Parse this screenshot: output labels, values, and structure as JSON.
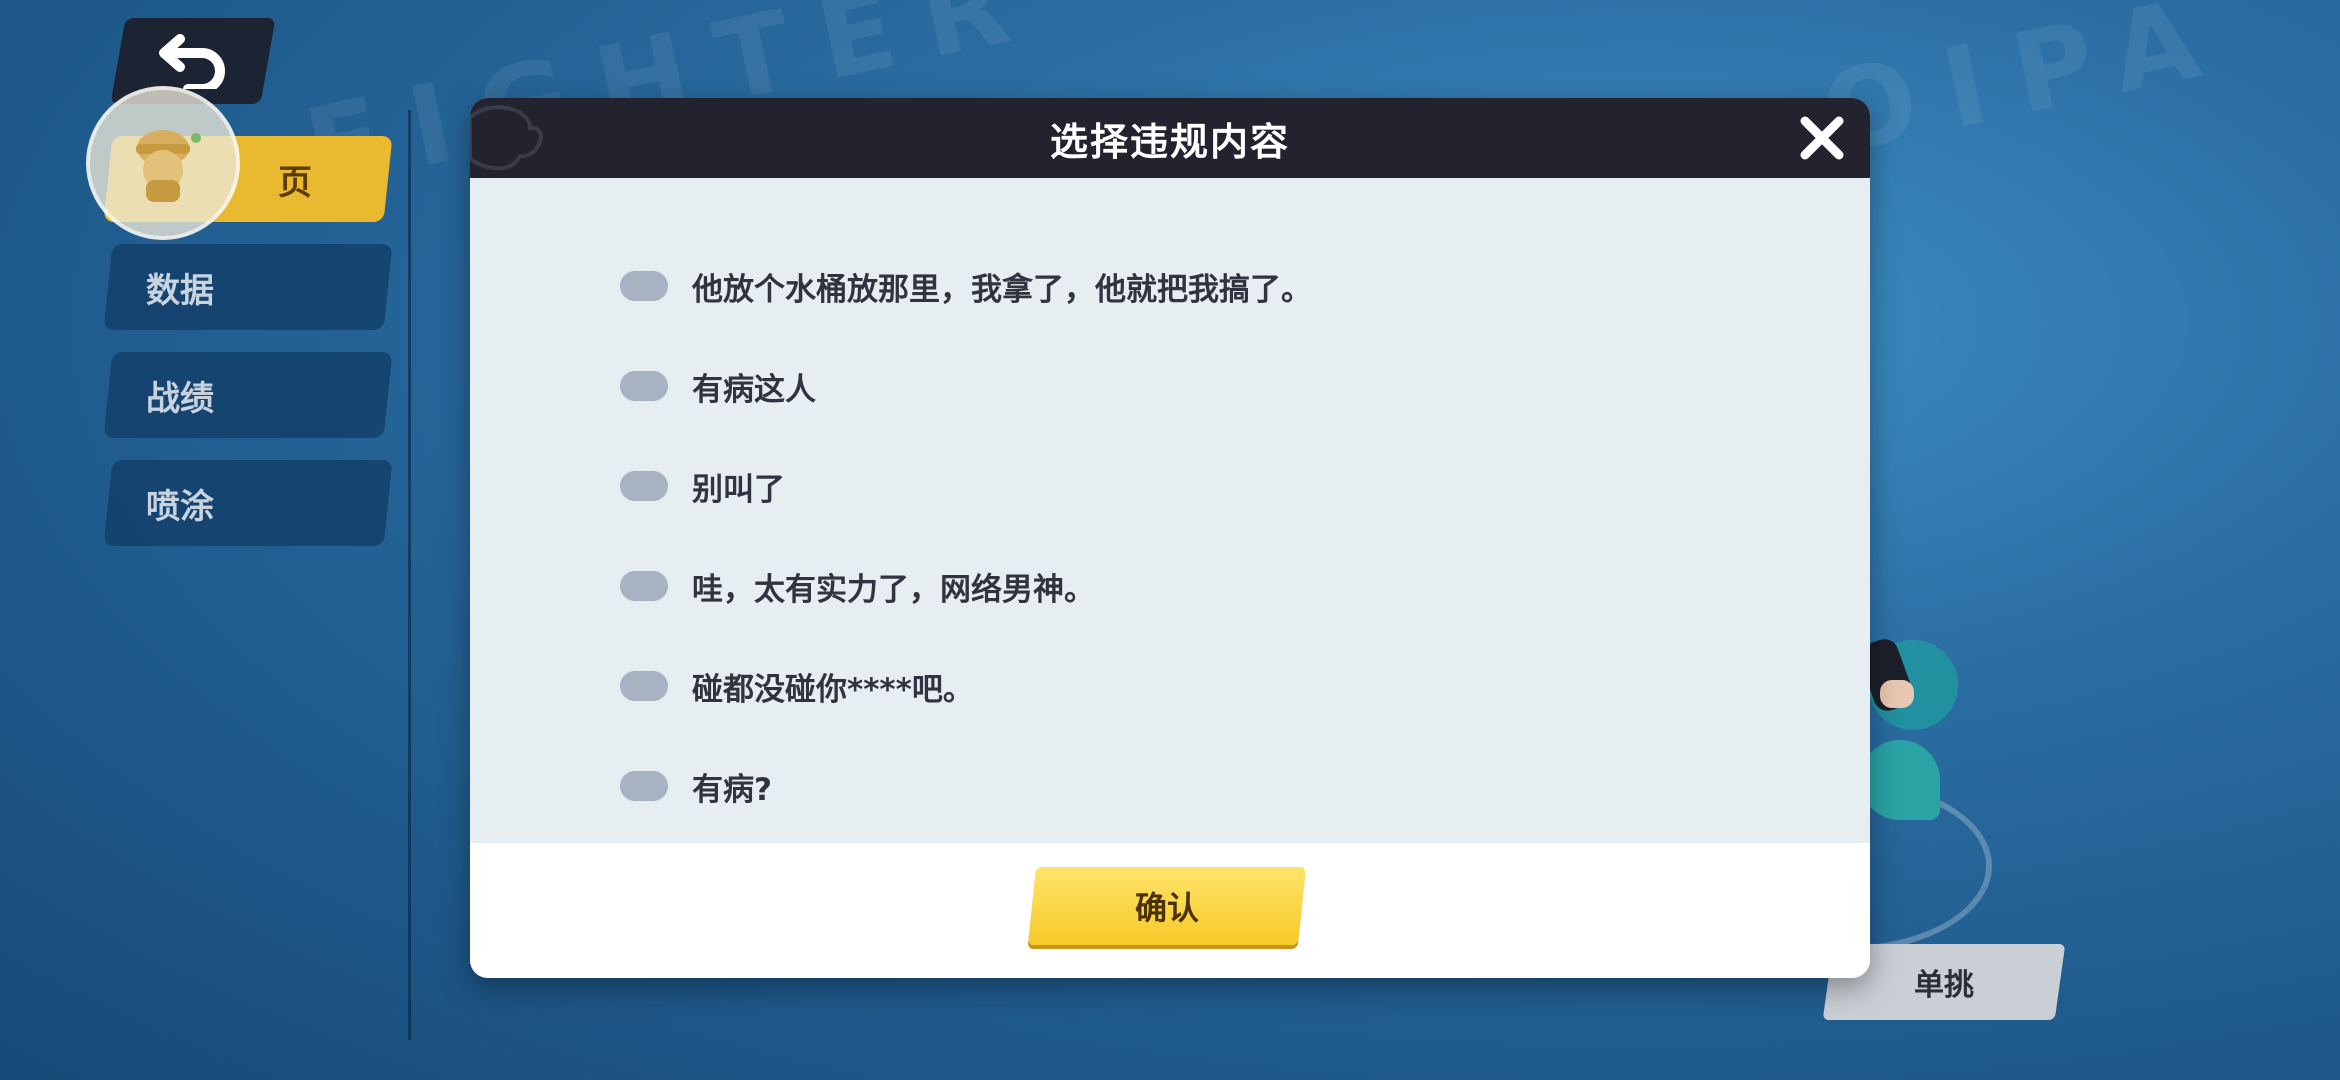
{
  "background": {
    "watermark_1": "FIGHTER",
    "watermark_2": "OIPA"
  },
  "navigation": {
    "back_icon": "back-arrow-icon",
    "tabs": [
      {
        "label": "页",
        "active": true
      },
      {
        "label": "数据",
        "active": false
      },
      {
        "label": "战绩",
        "active": false
      },
      {
        "label": "喷涂",
        "active": false
      }
    ]
  },
  "modal": {
    "title": "选择违规内容",
    "close_icon": "close-icon",
    "options": [
      "他放个水桶放那里，我拿了，他就把我搞了。",
      "有病这人",
      "别叫了",
      "哇，太有实力了，网络男神。",
      "碰都没碰你****吧。",
      "有病?"
    ],
    "confirm_label": "确认"
  },
  "solo_button": "单挑",
  "colors": {
    "header": "#22232f",
    "accent_yellow": "#f7c928",
    "checkbox": "#a7b2c2",
    "panel": "#e7eef2"
  }
}
